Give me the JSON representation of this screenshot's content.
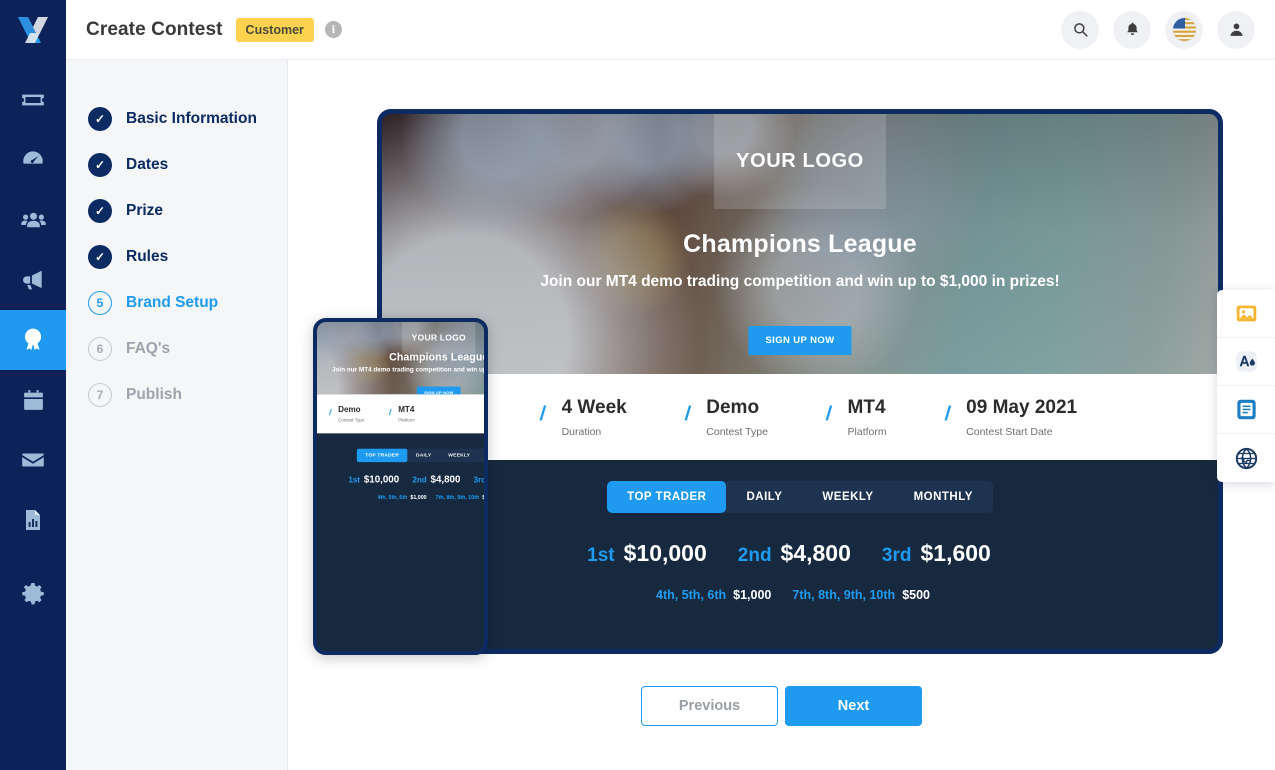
{
  "app": {
    "logo_icon": "x-logo-icon"
  },
  "header": {
    "title": "Create Contest",
    "badge": "Customer",
    "info_icon": "info-icon",
    "actions": [
      {
        "name": "search-icon"
      },
      {
        "name": "notifications-bell-icon"
      },
      {
        "name": "language-flag-icon"
      },
      {
        "name": "user-avatar-icon"
      }
    ]
  },
  "rail": {
    "items": [
      {
        "name": "ticket-icon",
        "active": false
      },
      {
        "name": "dashboard-gauge-icon",
        "active": false
      },
      {
        "name": "users-icon",
        "active": false
      },
      {
        "name": "megaphone-icon",
        "active": false
      },
      {
        "name": "award-badge-icon",
        "active": true
      },
      {
        "name": "calendar-icon",
        "active": false
      },
      {
        "name": "envelope-icon",
        "active": false
      },
      {
        "name": "report-chart-icon",
        "active": false
      },
      {
        "name": "settings-gear-icon",
        "active": false
      }
    ]
  },
  "steps": [
    {
      "mark": "✓",
      "label": "Basic Information",
      "state": "done"
    },
    {
      "mark": "✓",
      "label": "Dates",
      "state": "done"
    },
    {
      "mark": "✓",
      "label": "Prize",
      "state": "done"
    },
    {
      "mark": "✓",
      "label": "Rules",
      "state": "done"
    },
    {
      "mark": "5",
      "label": "Brand Setup",
      "state": "current"
    },
    {
      "mark": "6",
      "label": "FAQ's",
      "state": "todo"
    },
    {
      "mark": "7",
      "label": "Publish",
      "state": "todo"
    }
  ],
  "preview": {
    "logo_placeholder": "YOUR LOGO",
    "title": "Champions League",
    "subtitle": "Join our MT4 demo trading competition and win up to $1,000 in prizes!",
    "cta": "SIGN UP NOW",
    "info": [
      {
        "value": "4 Week",
        "label": "Duration"
      },
      {
        "value": "Demo",
        "label": "Contest Type"
      },
      {
        "value": "MT4",
        "label": "Platform"
      },
      {
        "value": "09 May 2021",
        "label": "Contest Start Date"
      }
    ],
    "tabs": [
      {
        "label": "TOP TRADER",
        "active": true
      },
      {
        "label": "DAILY",
        "active": false
      },
      {
        "label": "WEEKLY",
        "active": false
      },
      {
        "label": "MONTHLY",
        "active": false
      }
    ],
    "top_prizes": [
      {
        "rank": "1st",
        "amount": "$10,000"
      },
      {
        "rank": "2nd",
        "amount": "$4,800"
      },
      {
        "rank": "3rd",
        "amount": "$1,600"
      }
    ],
    "other_prizes": [
      {
        "rank": "4th, 5th, 6th",
        "amount": "$1,000"
      },
      {
        "rank": "7th, 8th, 9th, 10th",
        "amount": "$500"
      }
    ]
  },
  "tools": [
    {
      "name": "image-upload-icon"
    },
    {
      "name": "typography-color-icon"
    },
    {
      "name": "content-document-icon"
    },
    {
      "name": "globe-language-icon"
    }
  ],
  "footer": {
    "previous": "Previous",
    "next": "Next"
  },
  "colors": {
    "brand_navy": "#0c2259",
    "accent_blue": "#1e9bf0",
    "badge_yellow": "#fcd24f",
    "panel_dark": "#17293f",
    "steps_bg": "#f4f6f8"
  }
}
